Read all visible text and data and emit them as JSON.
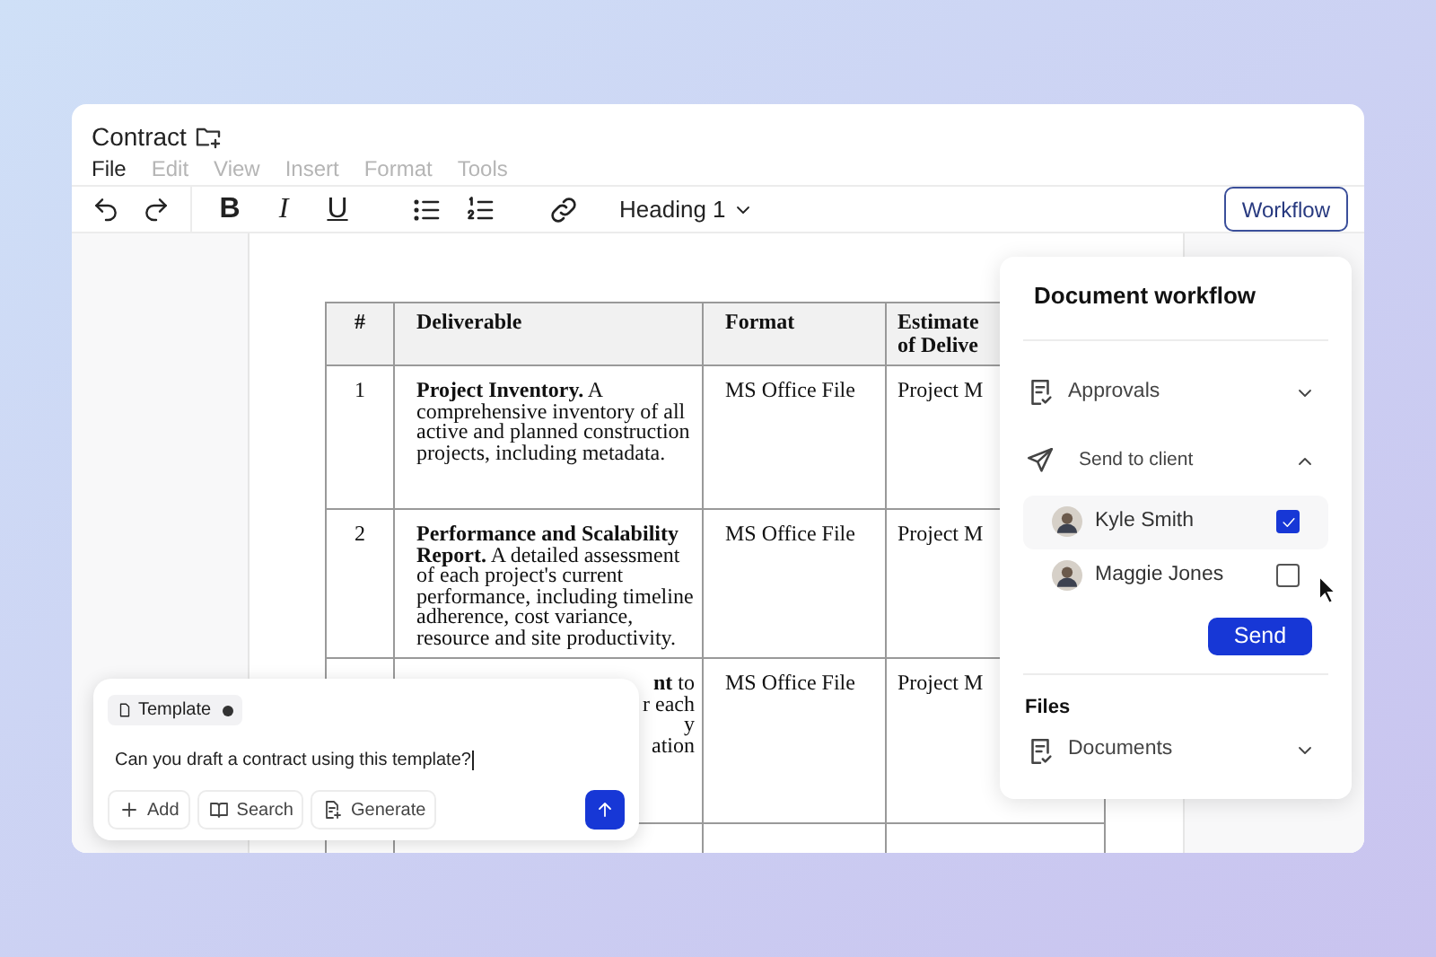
{
  "document": {
    "title": "Contract"
  },
  "menu": [
    {
      "label": "File",
      "disabled": false
    },
    {
      "label": "Edit",
      "disabled": true
    },
    {
      "label": "View",
      "disabled": true
    },
    {
      "label": "Insert",
      "disabled": true
    },
    {
      "label": "Format",
      "disabled": true
    },
    {
      "label": "Tools",
      "disabled": true
    }
  ],
  "toolbar": {
    "format_buttons": [
      {
        "label": "B",
        "kind": "bold"
      },
      {
        "label": "I",
        "kind": "italic"
      },
      {
        "label": "U",
        "kind": "underline"
      }
    ],
    "style_dropdown": "Heading 1",
    "workflow_button": "Workflow"
  },
  "table": {
    "columns": [
      "#",
      "Deliverable",
      "Format",
      "Estimate of Delive"
    ],
    "rows": [
      {
        "cells": [
          "1",
          "**Project Inventory.** A comprehensive inventory of all active and planned construction projects, including metadata.",
          "MS Office File",
          "Project M"
        ]
      },
      {
        "cells": [
          "2",
          "**Performance and Scalability Report.** A detailed assessment of each project's current performance, including timeline adherence, cost variance, resource and site productivity.",
          "MS Office File",
          "Project M"
        ]
      },
      {
        "cells": [
          "",
          "",
          "MS Office File",
          "Project M"
        ],
        "fragments": [
          "**nt** to",
          "r each",
          "y",
          "ation"
        ]
      }
    ]
  },
  "chat": {
    "attachment": "Template",
    "message": "Can you draft a contract using this template?",
    "actions": [
      {
        "label": "Add",
        "kind": "add"
      },
      {
        "label": "Search",
        "kind": "search"
      },
      {
        "label": "Generate",
        "kind": "generate"
      }
    ]
  },
  "workflow": {
    "title": "Document workflow",
    "sections": [
      {
        "label": "Approvals",
        "kind": "approvals",
        "expanded": false
      },
      {
        "label": "Send to client",
        "kind": "send",
        "expanded": true,
        "recipients": [
          {
            "name": "Kyle Smith",
            "checked": true
          },
          {
            "name": "Maggie Jones",
            "checked": false
          }
        ],
        "button": "Send"
      }
    ],
    "files_heading": "Files",
    "files": [
      {
        "label": "Documents",
        "expanded": false
      }
    ]
  }
}
